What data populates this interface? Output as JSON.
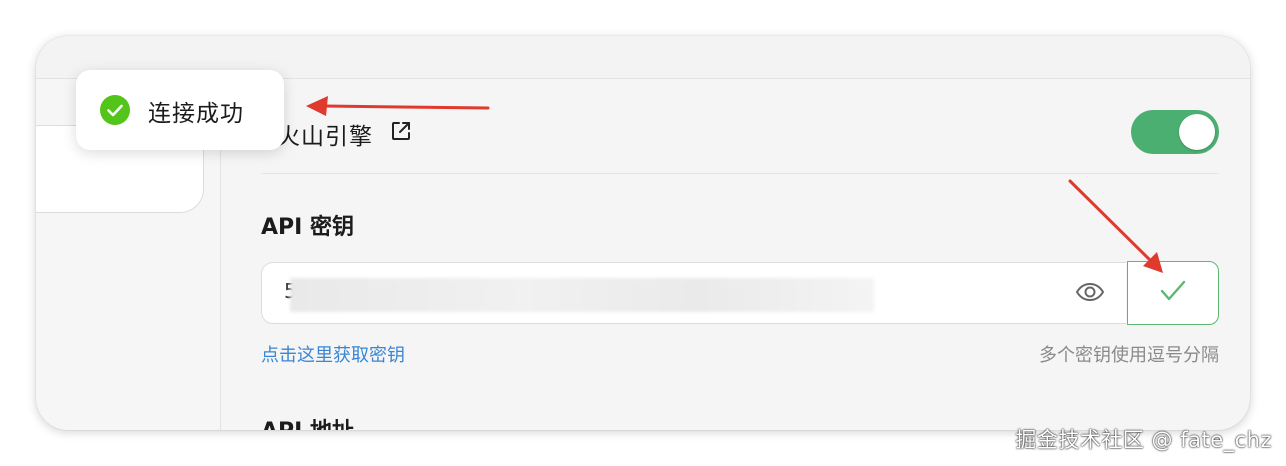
{
  "toast": {
    "message": "连接成功",
    "icon": "check-circle-icon",
    "color": "#52c41a"
  },
  "provider": {
    "name": "火山引擎",
    "visible_name": "火山引擎",
    "external_link_icon": "external-link-icon",
    "enabled": true,
    "toggle_color": "#4caf72"
  },
  "api_key": {
    "label": "API 密钥",
    "value": "5",
    "masked": true,
    "visibility_icon": "eye-icon",
    "check_icon": "check-icon",
    "check_color": "#5cb870",
    "get_key_link": "点击这里获取密钥",
    "hint": "多个密钥使用逗号分隔"
  },
  "api_address": {
    "label": "API 地址"
  },
  "watermark": "掘金技术社区 @ fate_chz",
  "colors": {
    "link": "#3a86d4",
    "annotation_arrow": "#e03a2f"
  }
}
